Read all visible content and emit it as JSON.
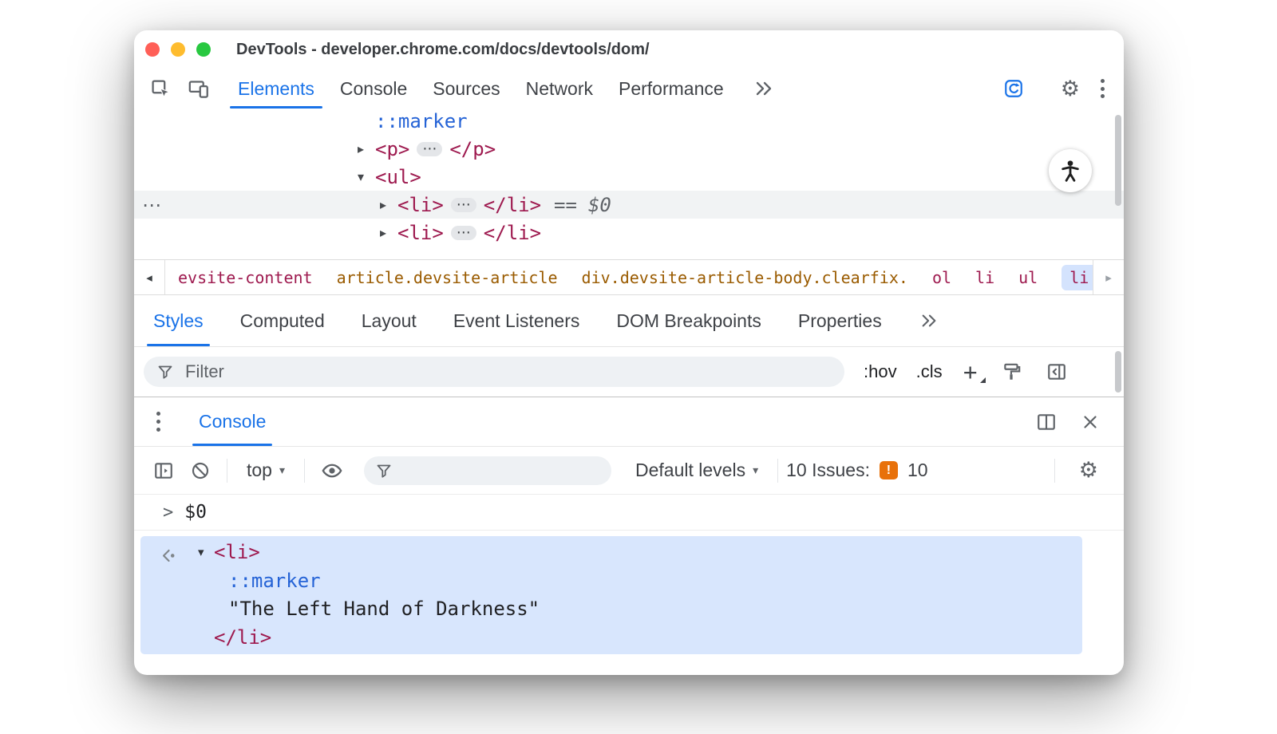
{
  "window": {
    "title": "DevTools - developer.chrome.com/docs/devtools/dom/"
  },
  "toolbar": {
    "tabs": [
      "Elements",
      "Console",
      "Sources",
      "Network",
      "Performance"
    ]
  },
  "elements_panel": {
    "marker": "::marker",
    "p_open": "<p>",
    "p_close": "</p>",
    "ul_open": "<ul>",
    "li_open": "<li>",
    "li_close": "</li>",
    "equals": "==",
    "dollar_zero": "$0"
  },
  "breadcrumbs": [
    "evsite-content",
    "article.devsite-article",
    "div.devsite-article-body.clearfix.",
    "ol",
    "li",
    "ul",
    "li"
  ],
  "styles_panel": {
    "tabs": [
      "Styles",
      "Computed",
      "Layout",
      "Event Listeners",
      "DOM Breakpoints",
      "Properties"
    ],
    "filter_placeholder": "Filter",
    "hov_label": ":hov",
    "cls_label": ".cls",
    "plus_label": "+"
  },
  "console": {
    "tab_label": "Console",
    "context_selector": "top",
    "levels_selector": "Default levels",
    "issues_label": "10 Issues:",
    "issues_count": "10",
    "eval_prompt": ">",
    "eval_expression": "$0",
    "result": {
      "li_open": "<li>",
      "marker": "::marker",
      "string": "\"The Left Hand of Darkness\"",
      "li_close": "</li>"
    }
  },
  "icons": {
    "expand_arrow": "▸",
    "collapse_arrow": "▾",
    "ellipsis_button": "⋯",
    "row_overflow": "⋯",
    "breadcrumb_back": "◂",
    "breadcrumb_forward": "▸",
    "dropdown_caret": "▾",
    "gear": "⚙",
    "issue_exclamation": "!"
  },
  "colors": {
    "accent_blue": "#1a73e8",
    "tag": "#9e1a4f",
    "class_attr": "#9a5b00",
    "pseudo": "#2563d6",
    "issue_orange": "#e8710a",
    "result_highlight": "#d8e6fd",
    "selected_row": "#f1f3f4"
  }
}
